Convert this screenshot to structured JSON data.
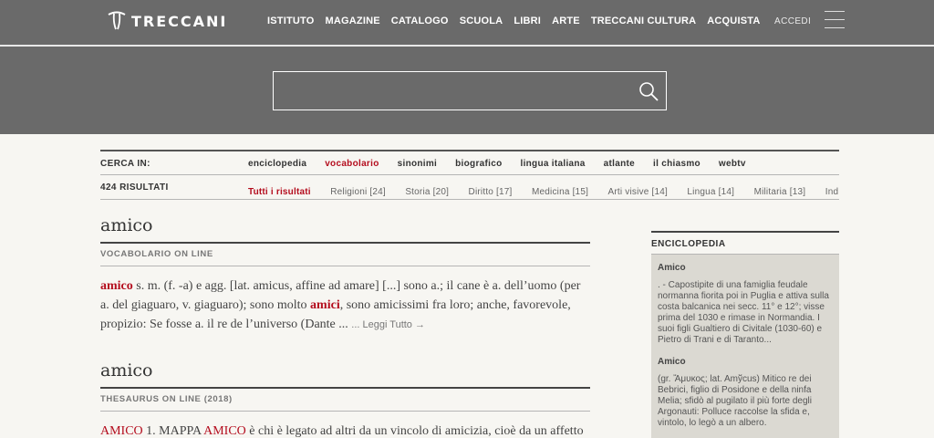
{
  "header": {
    "logo_text": "TRECCANI",
    "nav": [
      "ISTITUTO",
      "MAGAZINE",
      "CATALOGO",
      "SCUOLA",
      "LIBRI",
      "ARTE",
      "TRECCANI CULTURA",
      "ACQUISTA"
    ],
    "login_label": "ACCEDI",
    "search_value": ""
  },
  "filters": {
    "cerca_label": "CERCA IN:",
    "cerca_items": [
      "enciclopedia",
      "vocabolario",
      "sinonimi",
      "biografico",
      "lingua italiana",
      "atlante",
      "il chiasmo",
      "webtv"
    ],
    "cerca_active": "vocabolario",
    "results_label": "424 RISULTATI",
    "results_items": [
      "Tutti i risultati",
      "Religioni [24]",
      "Storia [20]",
      "Diritto [17]",
      "Medicina [15]",
      "Arti visive [14]",
      "Lingua [14]",
      "Militaria [13]",
      "Ind"
    ],
    "results_active": "Tutti i risultati"
  },
  "entries": [
    {
      "title": "amico",
      "source": "VOCABOLARIO ON LINE",
      "keyword": "amico",
      "text_1": " s. m. (f. -a) e agg. [lat. amicus, affine ad amare] [...] sono a.; il cane è a. dell’uomo (per a. del giaguaro, v. giaguaro); sono molto ",
      "keyword_2": "amici",
      "text_2": ", sono amicissimi fra loro; anche, favorevole, propizio: Se fosse a. il re de l’universo (Dante ... ",
      "more_label": "... Leggi Tutto →"
    },
    {
      "title": "amico",
      "source": "THESAURUS ON LINE (2018)",
      "keyword": "AMICO",
      "text_1": " 1. MAPPA ",
      "keyword_2": "AMICO",
      "text_2": " è chi è legato ad altri da un vincolo di amicizia, cioè da un affetto"
    }
  ],
  "sidebar": {
    "heading": "ENCICLOPEDIA",
    "items": [
      {
        "title": "Amico",
        "text": ". - Capostipite di una famiglia feudale normanna fiorita poi in Puglia e attiva sulla costa balcanica nei secc. 11° e 12°; visse prima del 1030 e rimase in Normandia. I suoi figli Gualtiero di Civitale (1030-60) e Pietro di Trani e di Taranto..."
      },
      {
        "title": "Amico",
        "text": "(gr. Ἄμυκος; lat. Amўcus) Mitico re dei Bebrici, figlio di Posidone e della ninfa Melia; sfidò al pugilato il più forte degli Argonauti: Polluce raccolse la sfida e, vintolo, lo legò a un albero."
      }
    ]
  }
}
